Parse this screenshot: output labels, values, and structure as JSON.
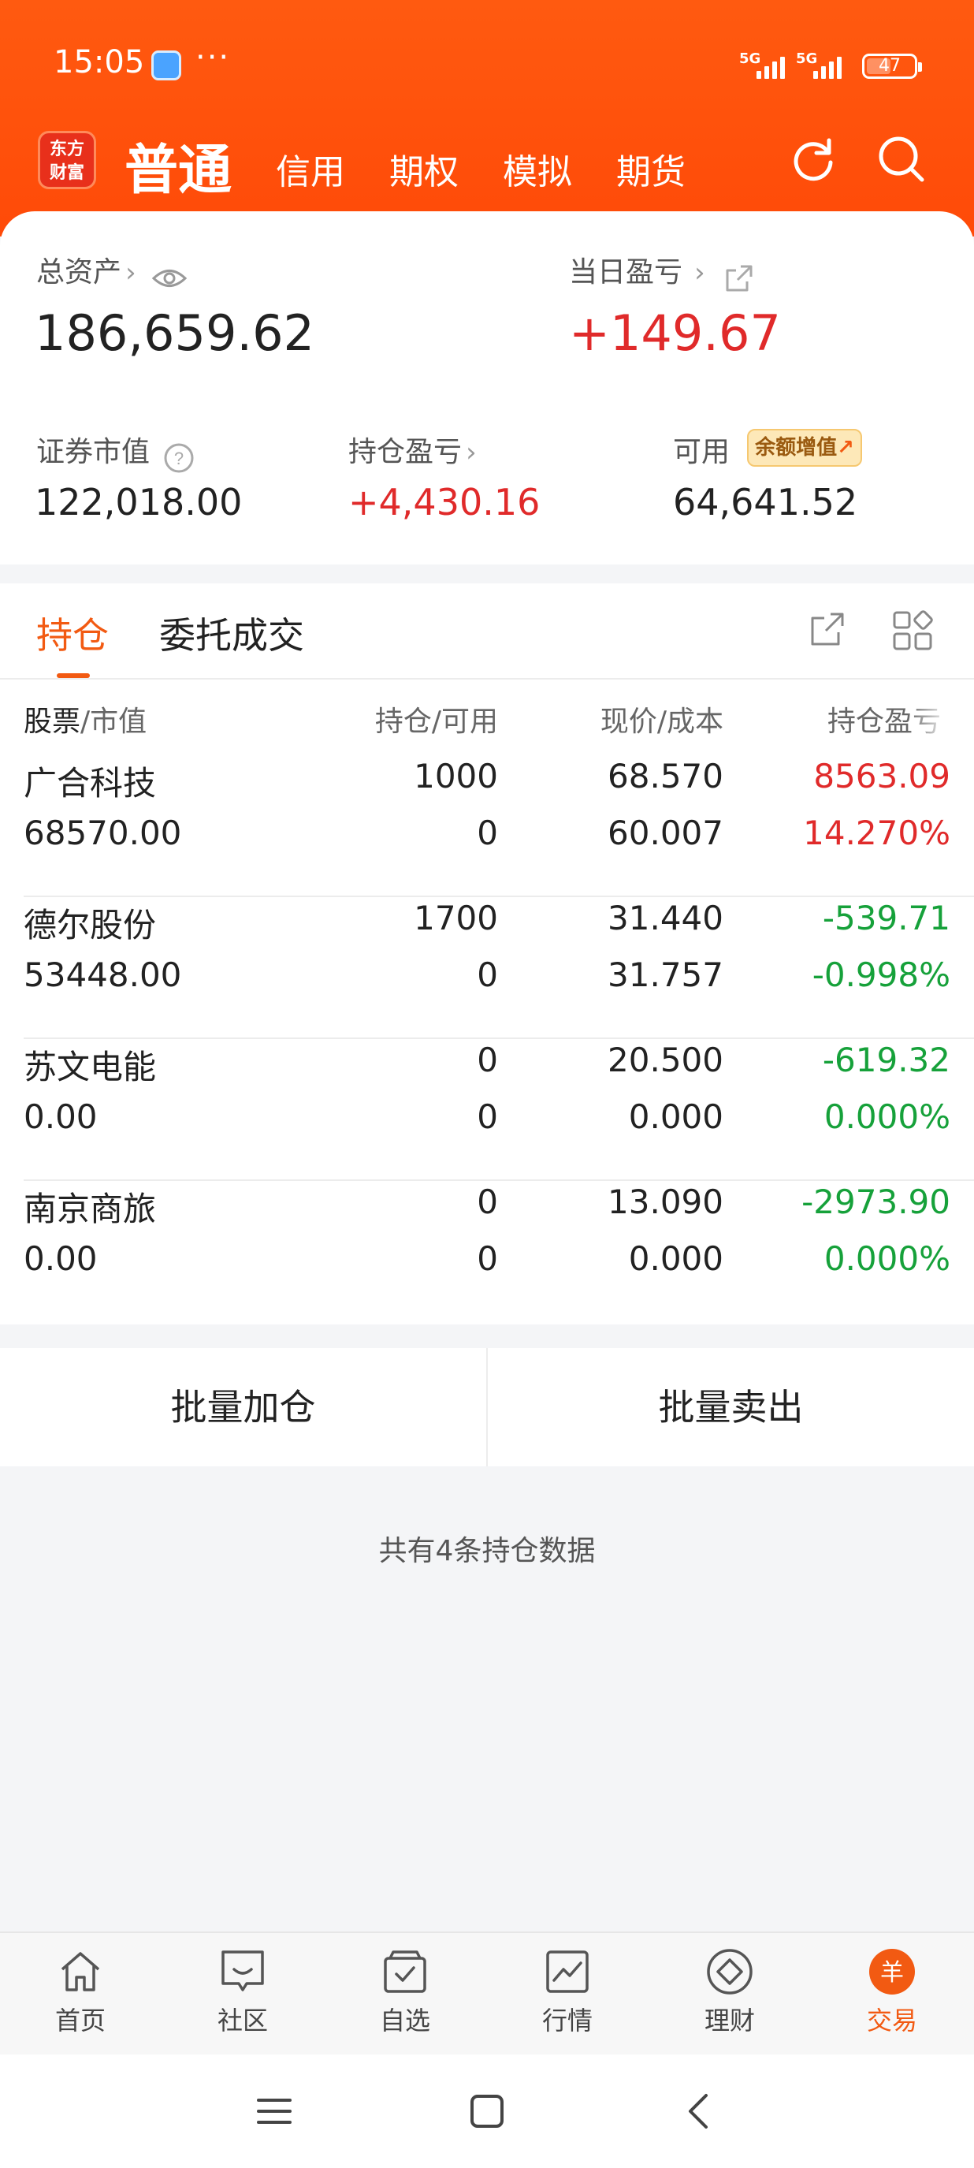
{
  "status_bar": {
    "time": "15:05",
    "dots": "···",
    "signal1": "5G",
    "signal2": "5G",
    "battery": "47"
  },
  "header": {
    "logo_line1": "东方",
    "logo_line2": "财富",
    "active_tab": "普通",
    "tabs": [
      "信用",
      "期权",
      "模拟",
      "期货"
    ]
  },
  "summary": {
    "total_assets_label": "总资产",
    "total_assets_value": "186,659.62",
    "daily_pl_label": "当日盈亏",
    "daily_pl_value": "+149.67",
    "securities_value_label": "证券市值",
    "securities_value": "122,018.00",
    "position_pl_label": "持仓盈亏",
    "position_pl_value": "+4,430.16",
    "available_label": "可用",
    "available_badge": "余额增值",
    "available_value": "64,641.52"
  },
  "holdings": {
    "tab_positions": "持仓",
    "tab_orders": "委托成交",
    "columns": {
      "stock": "股票",
      "market_value": "/市值",
      "qty": "持仓/可用",
      "price": "现价/成本",
      "pl": "持仓盈亏"
    },
    "rows": [
      {
        "name": "广合科技",
        "market_value": "68570.00",
        "qty": "1000",
        "available": "0",
        "price": "68.570",
        "cost": "60.007",
        "pl": "8563.09",
        "pl_pct": "14.270%",
        "tone": "red"
      },
      {
        "name": "德尔股份",
        "market_value": "53448.00",
        "qty": "1700",
        "available": "0",
        "price": "31.440",
        "cost": "31.757",
        "pl": "-539.71",
        "pl_pct": "-0.998%",
        "tone": "green"
      },
      {
        "name": "苏文电能",
        "market_value": "0.00",
        "qty": "0",
        "available": "0",
        "price": "20.500",
        "cost": "0.000",
        "pl": "-619.32",
        "pl_pct": "0.000%",
        "tone": "green"
      },
      {
        "name": "南京商旅",
        "market_value": "0.00",
        "qty": "0",
        "available": "0",
        "price": "13.090",
        "cost": "0.000",
        "pl": "-2973.90",
        "pl_pct": "0.000%",
        "tone": "green"
      }
    ]
  },
  "batch": {
    "add": "批量加仓",
    "sell": "批量卖出"
  },
  "footer_note": "共有4条持仓数据",
  "bottom_nav": [
    "首页",
    "社区",
    "自选",
    "行情",
    "理财",
    "交易"
  ],
  "trade_icon_glyph": "羊",
  "colors": {
    "brand": "#ff5a10",
    "accent": "#f25a12",
    "gain": "#e02a2a",
    "loss": "#16a13a"
  }
}
